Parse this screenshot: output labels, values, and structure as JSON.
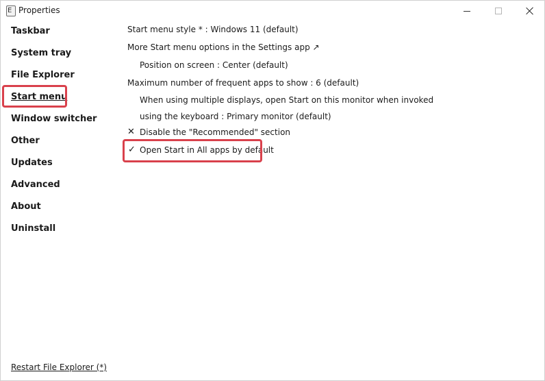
{
  "window": {
    "title": "Properties",
    "icon_glyph": "E",
    "icons": {
      "app": "app-icon",
      "minimize": "minimize-icon",
      "maximize": "maximize-icon",
      "close": "close-icon"
    }
  },
  "sidebar": {
    "items": [
      {
        "label": "Taskbar"
      },
      {
        "label": "System tray"
      },
      {
        "label": "File Explorer"
      },
      {
        "label": "Start menu",
        "active": true
      },
      {
        "label": "Window switcher"
      },
      {
        "label": "Other"
      },
      {
        "label": "Updates"
      },
      {
        "label": "Advanced"
      },
      {
        "label": "About"
      },
      {
        "label": "Uninstall"
      }
    ],
    "restart_link": "Restart File Explorer (*)"
  },
  "settings": {
    "start_menu_style": "Start menu style * : Windows 11 (default)",
    "more_options": "More Start menu options in the Settings app ↗",
    "position_on_screen": "Position on screen : Center (default)",
    "max_frequent_apps": "Maximum number of frequent apps to show : 6 (default)",
    "multi_display": "When using multiple displays, open Start on this monitor when invoked using the keyboard : Primary monitor (default)",
    "disable_recommended": {
      "label": "Disable the \"Recommended\" section",
      "mark": "✕",
      "state": "unchecked"
    },
    "open_all_apps": {
      "label": "Open Start in All apps by default",
      "mark": "✓",
      "state": "checked"
    }
  },
  "colors": {
    "highlight_border": "#d9414c",
    "text": "#1a1a1a",
    "background": "#ffffff"
  }
}
